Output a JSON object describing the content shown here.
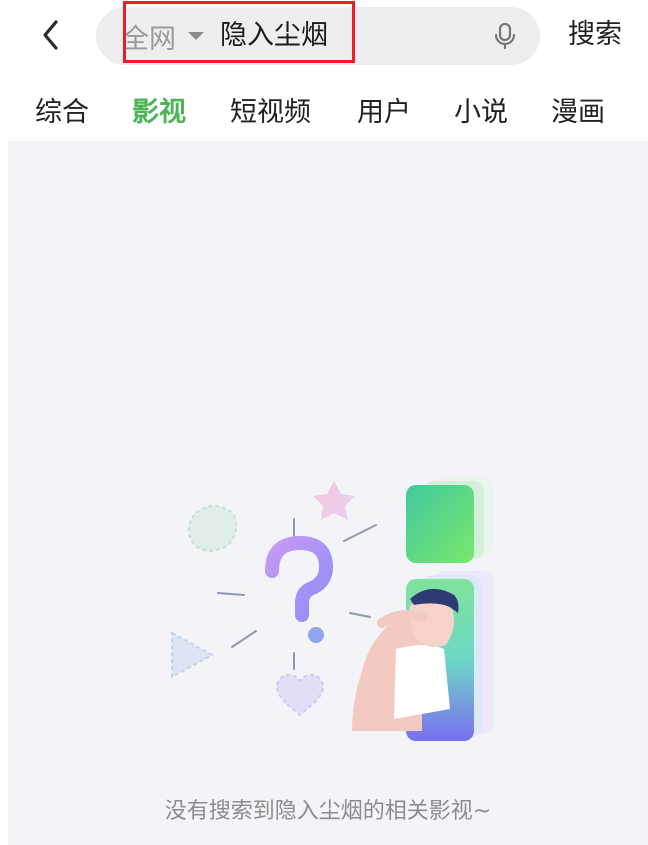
{
  "header": {
    "scope_label": "全网",
    "query": "隐入尘烟",
    "search_button": "搜索"
  },
  "tabs": [
    {
      "label": "综合",
      "active": false
    },
    {
      "label": "影视",
      "active": true
    },
    {
      "label": "短视频",
      "active": false
    },
    {
      "label": "用户",
      "active": false
    },
    {
      "label": "小说",
      "active": false
    },
    {
      "label": "漫画",
      "active": false
    }
  ],
  "empty_state": {
    "message": "没有搜索到隐入尘烟的相关影视~",
    "illustration": "confused-person-with-question-mark-icon"
  },
  "icons": {
    "back": "chevron-left-icon",
    "scope_caret": "caret-down-icon",
    "mic": "microphone-icon"
  },
  "colors": {
    "accent_tab": "#4bb453",
    "highlight_box": "#ef1c23",
    "search_box_bg": "#eeeef0",
    "content_bg": "#f3f4f8"
  }
}
